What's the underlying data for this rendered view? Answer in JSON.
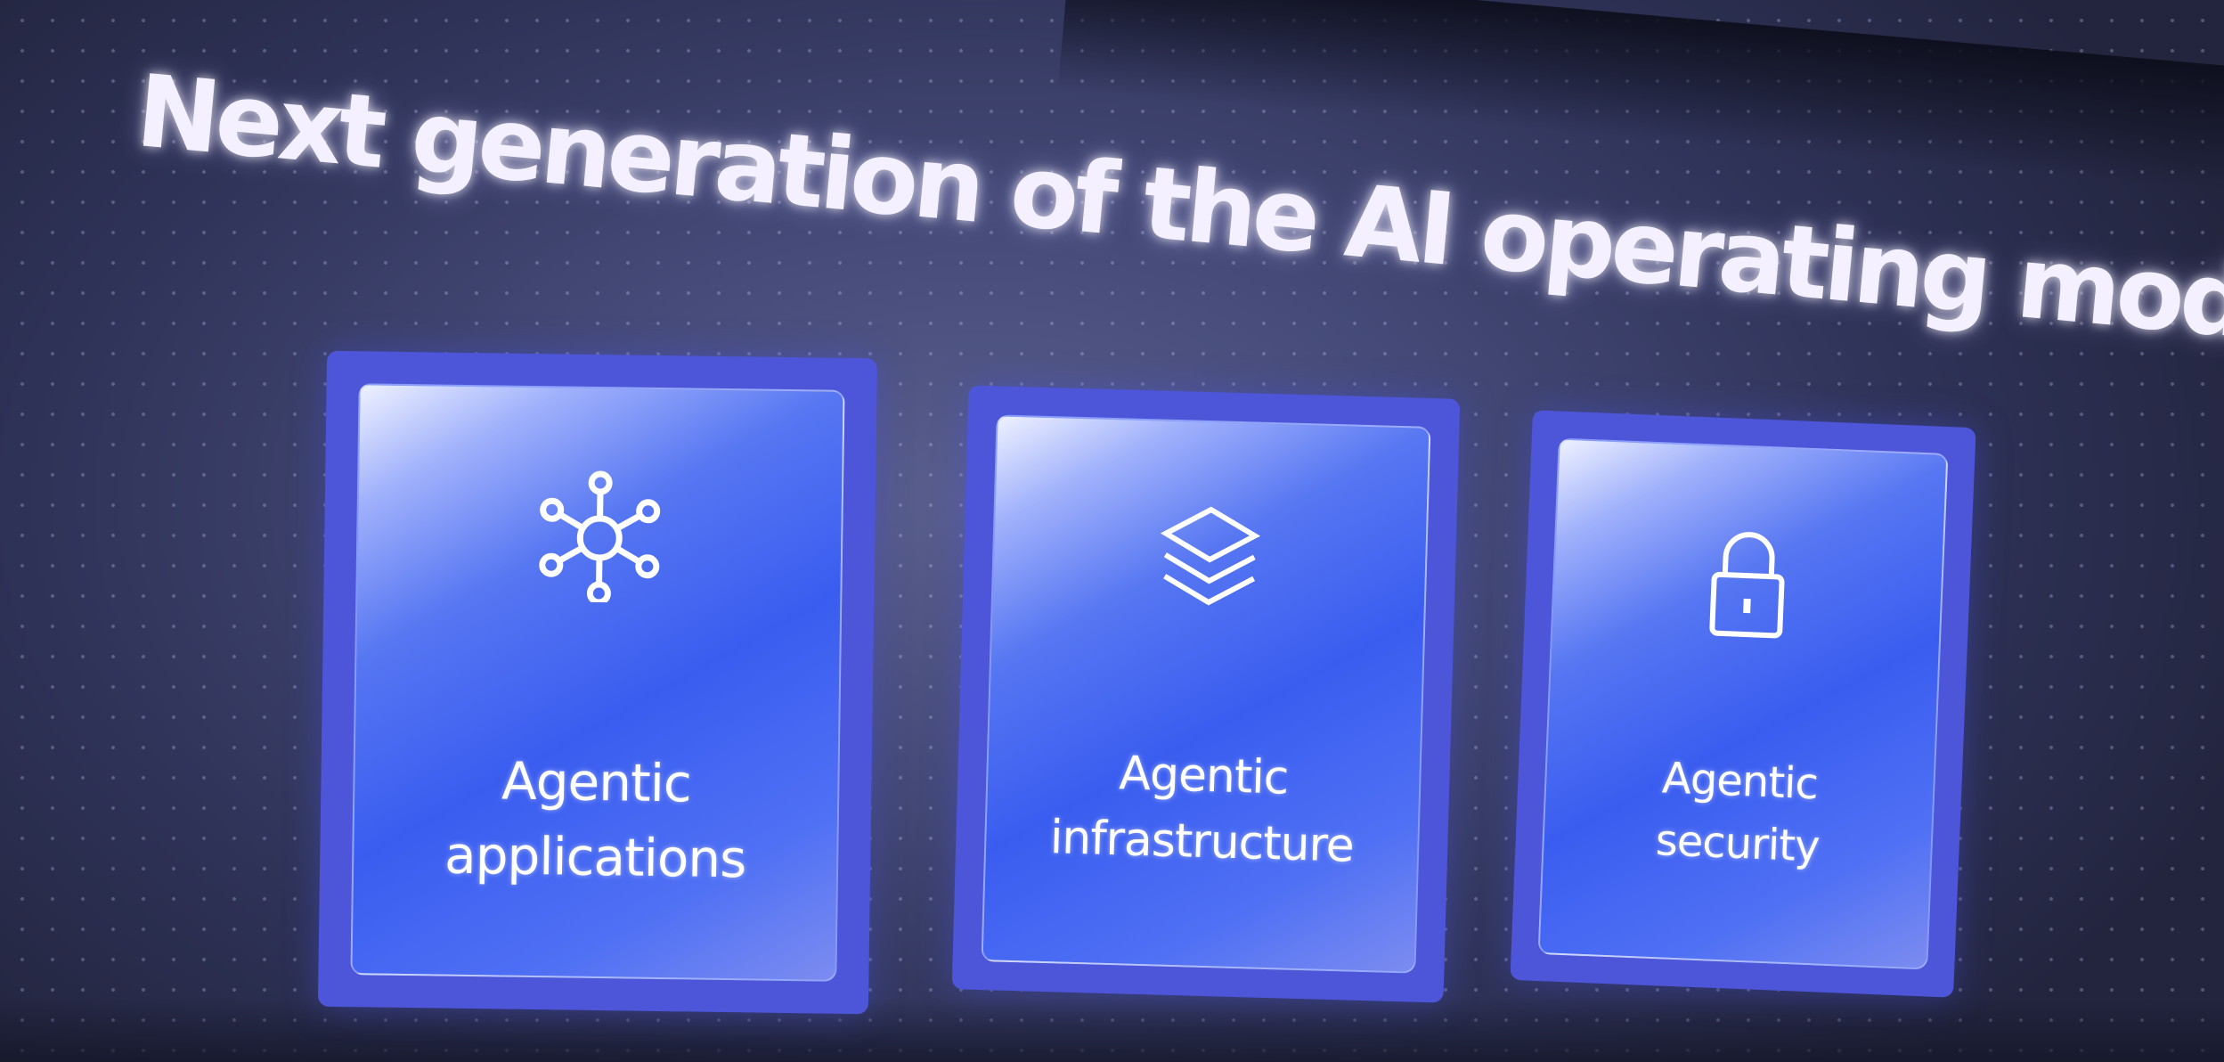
{
  "slide": {
    "title": "Next generation of the AI operating model",
    "cards": [
      {
        "line1": "Agentic",
        "line2": "applications",
        "icon": "network-hub-icon"
      },
      {
        "line1": "Agentic",
        "line2": "infrastructure",
        "icon": "stacked-layers-icon"
      },
      {
        "line1": "Agentic",
        "line2": "security",
        "icon": "padlock-icon"
      }
    ]
  },
  "colors": {
    "background": "#2f3358",
    "card_frame": "#4d55d8",
    "card_fill": "#3a5df0",
    "text": "#ffffff"
  }
}
